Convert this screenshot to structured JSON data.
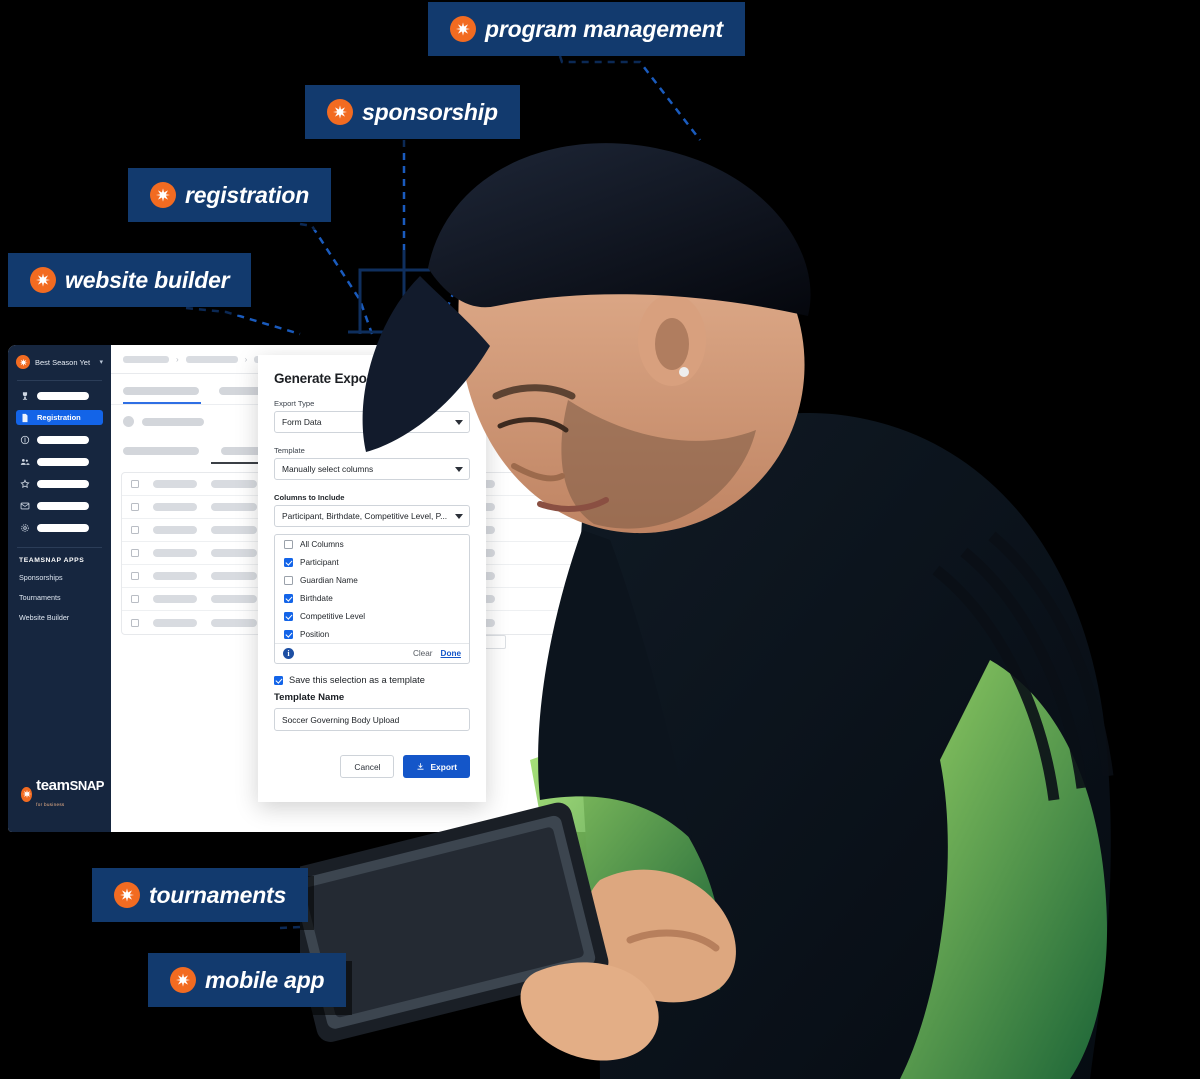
{
  "badges": [
    {
      "id": "program-management",
      "label": "program management",
      "icon": "asterisk-icon"
    },
    {
      "id": "sponsorship",
      "label": "sponsorship",
      "icon": "asterisk-icon"
    },
    {
      "id": "registration",
      "label": "registration",
      "icon": "asterisk-icon"
    },
    {
      "id": "website-builder",
      "label": "website builder",
      "icon": "asterisk-icon"
    },
    {
      "id": "tournaments",
      "label": "tournaments",
      "icon": "asterisk-icon"
    },
    {
      "id": "mobile-app",
      "label": "mobile app",
      "icon": "asterisk-icon"
    }
  ],
  "colors": {
    "badge_navy": "#123a6e",
    "brand_orange": "#f26b21",
    "accent_blue": "#1456c9",
    "sidebar_navy": "#16263f",
    "active_blue": "#1364e8"
  },
  "app": {
    "sidebar": {
      "org_name": "Best Season Yet",
      "org_chevron": "chevron-down-icon",
      "nav": [
        {
          "icon": "trophy-icon",
          "label": "",
          "active": false
        },
        {
          "icon": "document-icon",
          "label": "Registration",
          "active": true
        },
        {
          "icon": "dollar-icon",
          "label": "",
          "active": false
        },
        {
          "icon": "people-icon",
          "label": "",
          "active": false
        },
        {
          "icon": "star-icon",
          "label": "",
          "active": false
        },
        {
          "icon": "mail-icon",
          "label": "",
          "active": false
        },
        {
          "icon": "gear-icon",
          "label": "",
          "active": false
        }
      ],
      "apps_heading": "TEAMSNAP APPS",
      "apps": [
        "Sponsorships",
        "Tournaments",
        "Website Builder"
      ],
      "brand": {
        "name_1": "team",
        "name_2": "SNAP",
        "tagline": "for business"
      }
    },
    "main": {
      "breadcrumb_separator": "›",
      "skeleton_rows": 7
    }
  },
  "modal": {
    "title": "Generate Export",
    "export_type": {
      "label": "Export Type",
      "value": "Form Data"
    },
    "template": {
      "label": "Template",
      "value": "Manually select columns"
    },
    "columns_to_include": {
      "label": "Columns to Include",
      "value": "Participant, Birthdate, Competitive Level, P..."
    },
    "column_options": [
      {
        "label": "All Columns",
        "checked": false
      },
      {
        "label": "Participant",
        "checked": true
      },
      {
        "label": "Guardian Name",
        "checked": false
      },
      {
        "label": "Birthdate",
        "checked": true
      },
      {
        "label": "Competitive Level",
        "checked": true
      },
      {
        "label": "Position",
        "checked": true
      }
    ],
    "info_icon": "info-icon",
    "clear_label": "Clear",
    "done_label": "Done",
    "save_as_template": {
      "label": "Save this selection as a template",
      "checked": true
    },
    "template_name": {
      "label": "Template Name",
      "value": "Soccer Governing Body Upload"
    },
    "cancel_label": "Cancel",
    "export_label": "Export",
    "export_icon": "download-icon"
  }
}
